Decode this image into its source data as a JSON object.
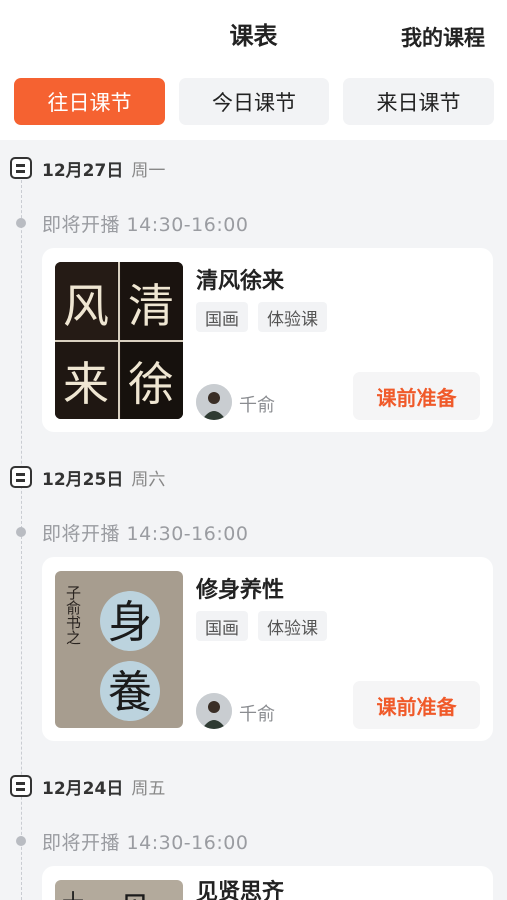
{
  "header": {
    "title": "课表",
    "right_link": "我的课程"
  },
  "tabs": [
    {
      "label": "往日课节",
      "active": true
    },
    {
      "label": "今日课节",
      "active": false
    },
    {
      "label": "来日课节",
      "active": false
    }
  ],
  "colors": {
    "accent": "#f56231",
    "button_text": "#f05a2a",
    "background": "#f3f4f6"
  },
  "sessions": [
    {
      "date": "12月27日",
      "weekday": "周一",
      "status": "即将开播 14:30-16:00",
      "course": {
        "title": "清风徐来",
        "tags": [
          "国画",
          "体验课"
        ],
        "teacher": "千俞",
        "button": "课前准备",
        "thumb_chars": [
          "风",
          "清",
          "来",
          "徐"
        ]
      }
    },
    {
      "date": "12月25日",
      "weekday": "周六",
      "status": "即将开播 14:30-16:00",
      "course": {
        "title": "修身养性",
        "tags": [
          "国画",
          "体验课"
        ],
        "teacher": "千俞",
        "button": "课前准备",
        "thumb_chars": [
          "身",
          "養",
          "子俞书之"
        ]
      }
    },
    {
      "date": "12月24日",
      "weekday": "周五",
      "status": "即将开播 14:30-16:00",
      "course": {
        "title": "见贤思齐",
        "thumb_chars": [
          "十",
          "见"
        ]
      }
    }
  ]
}
